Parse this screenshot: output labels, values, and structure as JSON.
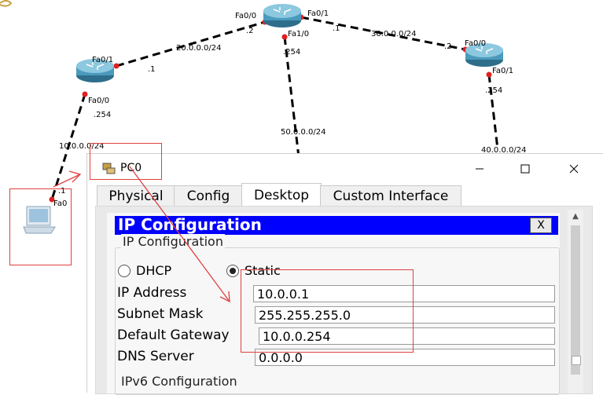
{
  "topology": {
    "links": {
      "net_20": "20.0.0.0/24",
      "net_30": "30.0.0.0/24",
      "net_50": "50.0.0.0/24",
      "net_40": "40.0.0.0/24",
      "net_10": "10.0.0.0/24"
    },
    "ports": {
      "r0_fa00": "Fa0/0",
      "r0_fa01": "Fa0/1",
      "r0_fa10": "Fa1/0",
      "r0_ip2": ".2",
      "r0_ip1": ".1",
      "r0_ip254": ".254",
      "r1_fa01": "Fa0/1",
      "r1_fa00": "Fa0/0",
      "r1_ip1": ".1",
      "r1_ip254": ".254",
      "r2_fa00": "Fa0/0",
      "r2_fa01": "Fa0/1",
      "r2_ip2": ".2",
      "r2_ip254": ".254",
      "pc_fa0": "Fa0",
      "pc_ip1": ".1"
    }
  },
  "window": {
    "title": "PC0",
    "tabs": [
      "Physical",
      "Config",
      "Desktop",
      "Custom Interface"
    ],
    "active_tab": "Desktop"
  },
  "ipconfig": {
    "heading": "IP Configuration",
    "close_label": "X",
    "group_title": "IP Configuration",
    "dhcp_label": "DHCP",
    "static_label": "Static",
    "mode": "Static",
    "ip_label": "IP Address",
    "ip_value": "10.0.0.1",
    "mask_label": "Subnet Mask",
    "mask_value": "255.255.255.0",
    "gw_label": "Default Gateway",
    "gw_value": "10.0.0.254",
    "dns_label": "DNS Server",
    "dns_value": "0.0.0.0",
    "ipv6_title": "IPv6 Configuration"
  },
  "colors": {
    "ip_bar": "#0000ff",
    "annotation": "#e04040",
    "link_dot": "#e02020"
  }
}
